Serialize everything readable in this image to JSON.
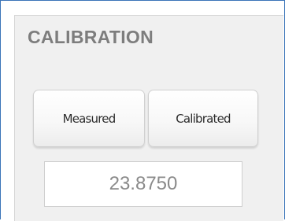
{
  "panel": {
    "title": "CALIBRATION",
    "buttons": {
      "measured_label": "Measured",
      "calibrated_label": "Calibrated"
    },
    "value": "23.8750"
  },
  "colors": {
    "window_border": "#3b74b8",
    "panel_background": "#f0f0f0",
    "title_text": "#7d7d7d",
    "value_text": "#8a8a8a"
  }
}
